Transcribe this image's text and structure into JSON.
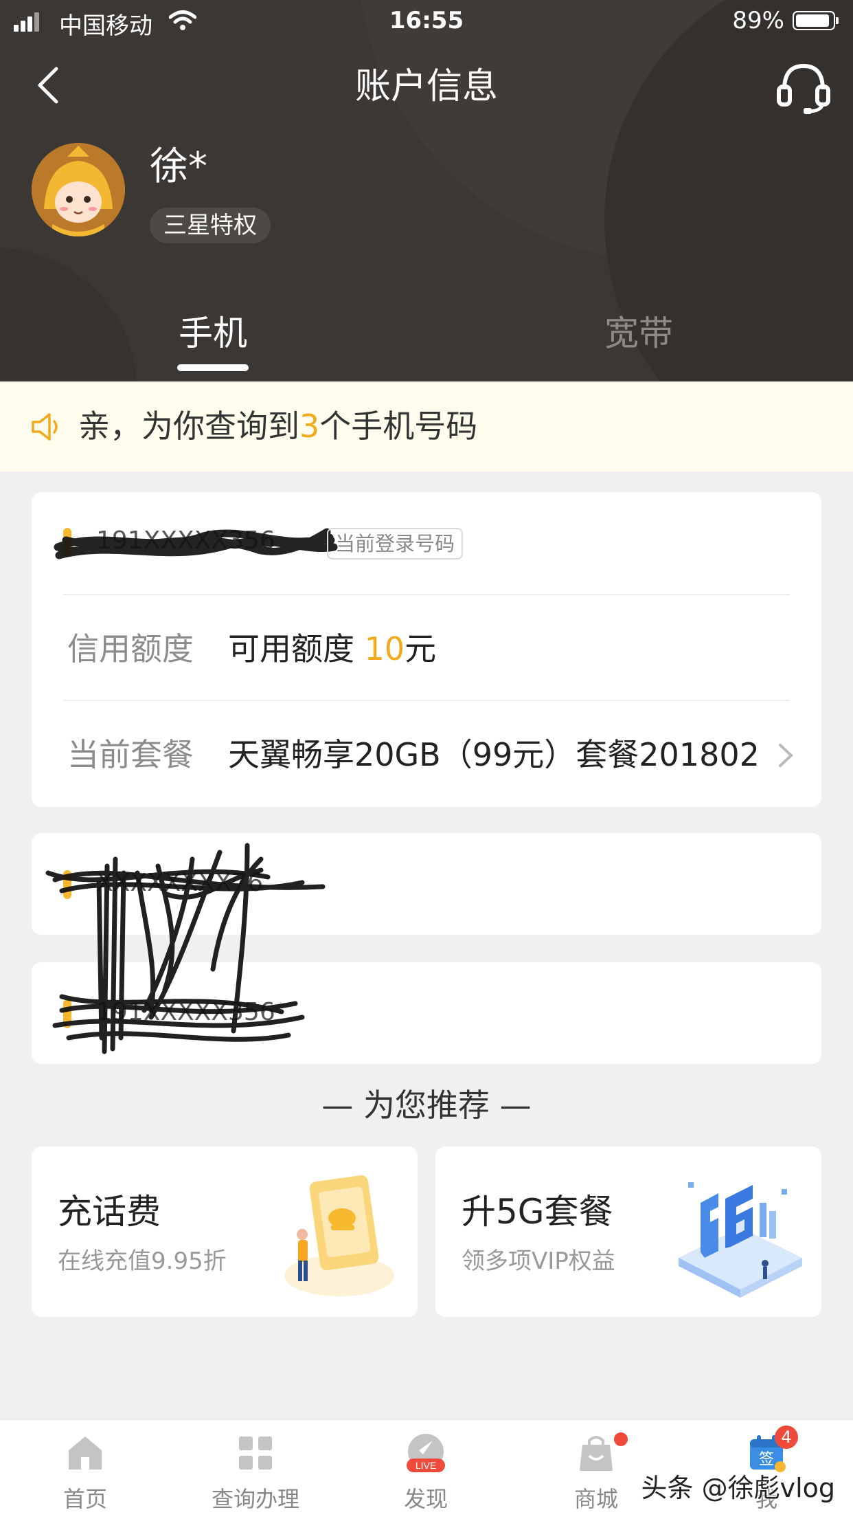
{
  "status_bar": {
    "carrier": "中国移动",
    "time": "16:55",
    "battery": "89%"
  },
  "nav": {
    "title": "账户信息"
  },
  "user": {
    "name": "徐*",
    "level": "三星特权"
  },
  "tabs": [
    {
      "label": "手机",
      "active": true
    },
    {
      "label": "宽带",
      "active": false
    }
  ],
  "notice": {
    "prefix": "亲，为你查询到",
    "count": "3",
    "suffix": "个手机号码"
  },
  "phones": [
    {
      "number_masked": "191XXXXX356",
      "badge": "当前登录号码",
      "credit_label": "信用额度",
      "credit_prefix": "可用额度",
      "credit_amount": "10",
      "credit_unit": "元",
      "plan_label": "当前套餐",
      "plan_value": "天翼畅享20GB（99元）套餐201802"
    },
    {
      "number_masked": "XXXXXXXX76"
    },
    {
      "number_masked": "191XXXXX356"
    }
  ],
  "recommend": {
    "title": "— 为您推荐 —",
    "items": [
      {
        "title": "充话费",
        "subtitle": "在线充值9.95折"
      },
      {
        "title": "升5G套餐",
        "subtitle": "领多项VIP权益"
      }
    ]
  },
  "tabbar": {
    "items": [
      {
        "label": "首页",
        "icon": "home-icon"
      },
      {
        "label": "查询办理",
        "icon": "grid-icon"
      },
      {
        "label": "发现",
        "icon": "live-icon",
        "icon_text": "LIVE"
      },
      {
        "label": "商城",
        "icon": "shopping-bag-icon"
      },
      {
        "label": "我",
        "icon": "sign-in-calendar-icon",
        "icon_text": "签",
        "badge": "4"
      }
    ]
  },
  "watermark": "头条 @徐彪vlog",
  "colors": {
    "header_bg": "#3b3734",
    "accent": "#f2a91c",
    "notice_bg": "#fffdee",
    "badge_red": "#f04b3a"
  }
}
